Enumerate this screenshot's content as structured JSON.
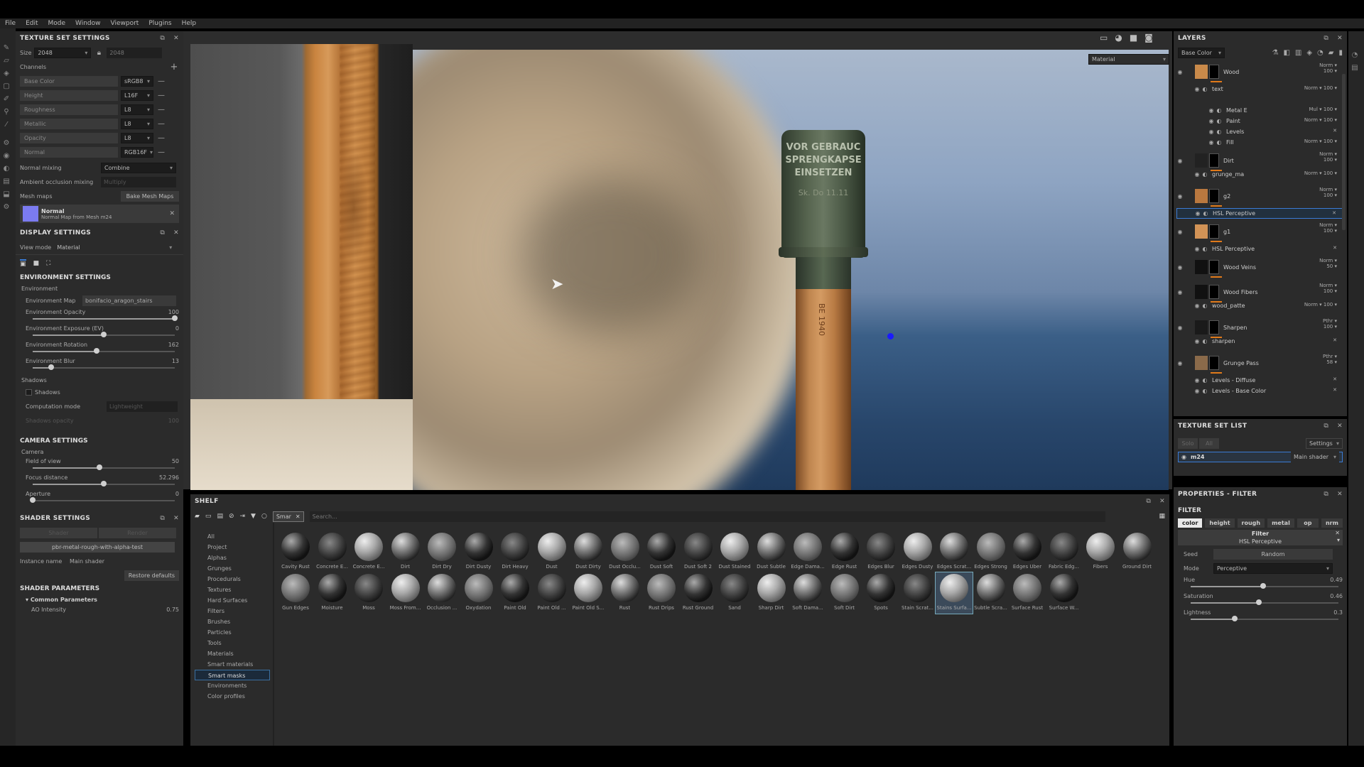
{
  "menu": [
    "File",
    "Edit",
    "Mode",
    "Window",
    "Viewport",
    "Plugins",
    "Help"
  ],
  "texture_set_settings": {
    "title": "TEXTURE SET SETTINGS",
    "size_label": "Size",
    "size_value": "2048",
    "size_linked": "2048",
    "channels_label": "Channels",
    "channels": [
      {
        "name": "Base Color",
        "format": "sRGB8"
      },
      {
        "name": "Height",
        "format": "L16F"
      },
      {
        "name": "Roughness",
        "format": "L8"
      },
      {
        "name": "Metallic",
        "format": "L8"
      },
      {
        "name": "Opacity",
        "format": "L8"
      },
      {
        "name": "Normal",
        "format": "RGB16F"
      }
    ],
    "normal_mixing_label": "Normal mixing",
    "normal_mixing_value": "Combine",
    "ao_mixing_label": "Ambient occlusion mixing",
    "ao_mixing_value": "Multiply",
    "mesh_maps_label": "Mesh maps",
    "bake_button": "Bake Mesh Maps",
    "mesh_map_name": "Normal",
    "mesh_map_desc": "Normal Map from Mesh m24"
  },
  "display_settings": {
    "title": "DISPLAY SETTINGS",
    "view_mode_label": "View mode",
    "view_mode_value": "Material"
  },
  "environment": {
    "title": "ENVIRONMENT SETTINGS",
    "sub": "Environment",
    "map_label": "Environment Map",
    "map_value": "bonifacio_aragon_stairs",
    "opacity_label": "Environment Opacity",
    "opacity_value": "100",
    "opacity_frac": 1.0,
    "exposure_label": "Environment Exposure (EV)",
    "exposure_value": "0",
    "exposure_frac": 0.5,
    "rotation_label": "Environment Rotation",
    "rotation_value": "162",
    "rotation_frac": 0.45,
    "blur_label": "Environment Blur",
    "blur_value": "13",
    "blur_frac": 0.13,
    "shadows_sub": "Shadows",
    "shadows_label": "Shadows",
    "computation_label": "Computation mode",
    "computation_value": "Lightweight",
    "shadows_opacity_label": "Shadows opacity",
    "shadows_opacity_value": "100"
  },
  "camera": {
    "title": "CAMERA SETTINGS",
    "sub": "Camera",
    "fov_label": "Field of view",
    "fov_value": "50",
    "fov_frac": 0.47,
    "focus_label": "Focus distance",
    "focus_value": "52.296",
    "focus_frac": 0.5,
    "aperture_label": "Aperture",
    "aperture_value": "0",
    "aperture_frac": 0.0
  },
  "shader": {
    "title": "SHADER SETTINGS",
    "tab1": "Shader",
    "tab2": "Render",
    "shader_name": "pbr-metal-rough-with-alpha-test",
    "instance_label": "Instance name",
    "instance_value": "Main shader",
    "restore_button": "Restore defaults",
    "params_title": "SHADER PARAMETERS",
    "common_title": "Common Parameters",
    "ao_label": "AO Intensity",
    "ao_value": "0.75"
  },
  "viewport": {
    "mode_dropdown": "Material",
    "engraving_lines": [
      "VOR GEBRAUC",
      "SPRENGKAPSE",
      "EINSETZEN",
      "Sk. Do 11.11"
    ],
    "handle_text": "BE 1940"
  },
  "shelf": {
    "title": "SHELF",
    "filter_chip": "Smar",
    "search_placeholder": "Search...",
    "categories": [
      "All",
      "Project",
      "Alphas",
      "Grunges",
      "Procedurals",
      "Textures",
      "Hard Surfaces",
      "Filters",
      "Brushes",
      "Particles",
      "Tools",
      "Materials",
      "Smart materials",
      "Smart masks",
      "Environments",
      "Color profiles"
    ],
    "selected_category": "Smart masks",
    "row1": [
      "Cavity Rust",
      "Concrete E...",
      "Concrete E...",
      "Dirt",
      "Dirt Dry",
      "Dirt Dusty",
      "Dirt Heavy",
      "Dust",
      "Dust Dirty",
      "Dust Occlu...",
      "Dust Soft",
      "Dust Soft 2",
      "Dust Stained",
      "Dust Subtle",
      "Edge Dama...",
      "Edge Rust",
      "Edges Blur",
      "Edges Dusty",
      "Edges Scrat...",
      "Edges Strong",
      "Edges Uber",
      "Fabric Edg...",
      "Fibers",
      "Ground Dirt"
    ],
    "row2": [
      "Gun Edges",
      "Moisture",
      "Moss",
      "Moss From...",
      "Occlusion ...",
      "Oxydation",
      "Paint Old",
      "Paint Old ...",
      "Paint Old S...",
      "Rust",
      "Rust Drips",
      "Rust Ground",
      "Sand",
      "Sharp Dirt",
      "Soft Dama...",
      "Soft Dirt",
      "Spots",
      "Stain Scrat...",
      "Stains Surfa...",
      "Subtle Scra...",
      "Surface Rust",
      "Surface W..."
    ],
    "selected_item": "Stains Surfa..."
  },
  "layers": {
    "title": "LAYERS",
    "channel_dropdown": "Base Color",
    "items": [
      {
        "name": "Wood",
        "mode": "Norm",
        "opacity": "100"
      },
      {
        "name": "text",
        "mode": "Norm",
        "opacity": "100"
      },
      {
        "name": "Metal E",
        "mode": "Mul",
        "opacity": "100"
      },
      {
        "name": "Paint",
        "mode": "Norm",
        "opacity": "100"
      },
      {
        "name": "Levels",
        "mode": "",
        "opacity": ""
      },
      {
        "name": "Fill",
        "mode": "Norm",
        "opacity": "100"
      },
      {
        "name": "Dirt",
        "mode": "Norm",
        "opacity": "100"
      },
      {
        "name": "grunge_ma",
        "mode": "Norm",
        "opacity": "100"
      },
      {
        "name": "g2",
        "mode": "Norm",
        "opacity": "100"
      },
      {
        "name": "HSL Perceptive",
        "mode": "",
        "opacity": ""
      },
      {
        "name": "g1",
        "mode": "Norm",
        "opacity": "100"
      },
      {
        "name": "HSL Perceptive",
        "mode": "",
        "opacity": ""
      },
      {
        "name": "Wood Veins",
        "mode": "Norm",
        "opacity": "50"
      },
      {
        "name": "Wood Fibers",
        "mode": "Norm",
        "opacity": "100"
      },
      {
        "name": "wood_patte",
        "mode": "Norm",
        "opacity": "100"
      },
      {
        "name": "Sharpen",
        "mode": "Pthr",
        "opacity": "100"
      },
      {
        "name": "sharpen",
        "mode": "",
        "opacity": ""
      },
      {
        "name": "Grunge Pass",
        "mode": "Pthr",
        "opacity": "58"
      },
      {
        "name": "Levels - Diffuse",
        "mode": "",
        "opacity": ""
      },
      {
        "name": "Levels - Base Color",
        "mode": "",
        "opacity": ""
      }
    ]
  },
  "texture_set_list": {
    "title": "TEXTURE SET LIST",
    "solo": "Solo",
    "all": "All",
    "settings": "Settings",
    "item": "m24",
    "shader": "Main shader"
  },
  "properties": {
    "title": "PROPERTIES - FILTER",
    "filter_label": "FILTER",
    "tabs": [
      "color",
      "height",
      "rough",
      "metal",
      "op",
      "nrm"
    ],
    "selected_tab": "color",
    "filter_header": "Filter",
    "filter_name": "HSL Perceptive",
    "seed_label": "Seed",
    "seed_value": "Random",
    "mode_label": "Mode",
    "mode_value": "Perceptive",
    "hue_label": "Hue",
    "hue_value": "0.49",
    "hue_frac": 0.49,
    "sat_label": "Saturation",
    "sat_value": "0.46",
    "sat_frac": 0.46,
    "light_label": "Lightness",
    "light_value": "0.3",
    "light_frac": 0.3
  },
  "colors": {
    "accent": "#3a7bd5",
    "mesh_map_swatch": "#7b7bf0",
    "cursor_dot": "#1a1aff"
  }
}
